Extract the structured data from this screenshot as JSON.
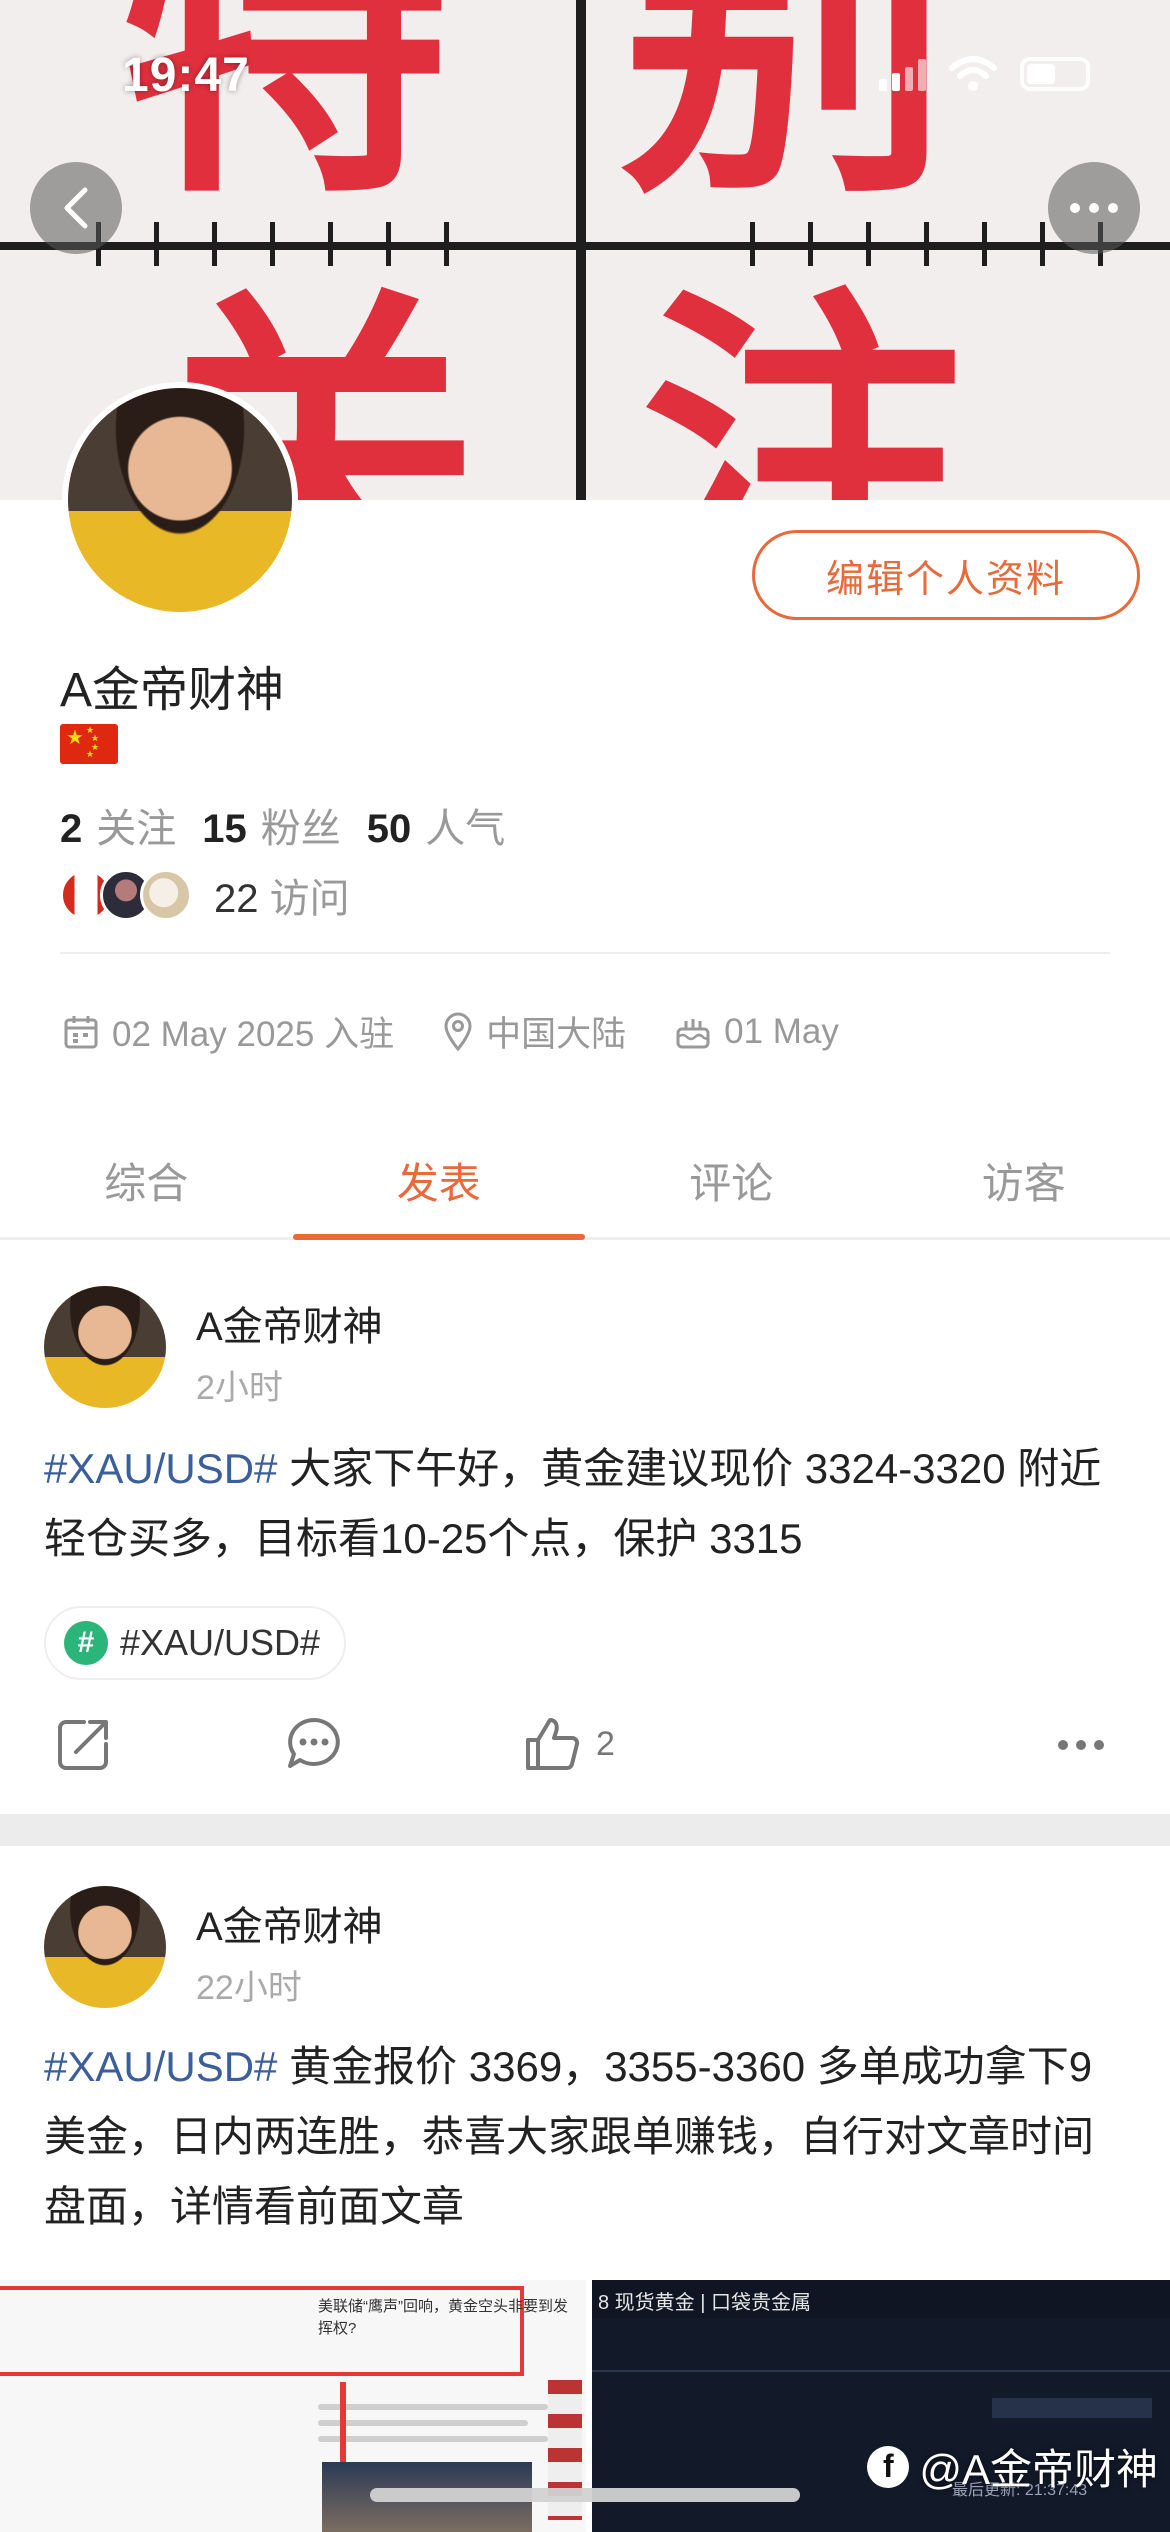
{
  "status_bar": {
    "time": "19:47"
  },
  "banner": {
    "glyphs": [
      "特",
      "别",
      "关",
      "注"
    ]
  },
  "profile": {
    "username": "A金帝财神",
    "edit_button": "编辑个人资料",
    "stats": [
      {
        "value": "2",
        "label": "关注"
      },
      {
        "value": "15",
        "label": "粉丝"
      },
      {
        "value": "50",
        "label": "人气"
      }
    ],
    "visits": {
      "value": "22",
      "label": "访问"
    },
    "joined": "02 May 2025 入驻",
    "location": "中国大陆",
    "birthday": "01 May"
  },
  "tabs": [
    {
      "label": "综合",
      "active": false
    },
    {
      "label": "发表",
      "active": true
    },
    {
      "label": "评论",
      "active": false
    },
    {
      "label": "访客",
      "active": false
    }
  ],
  "posts": [
    {
      "author": "A金帝财神",
      "time": "2小时",
      "tag": "#XAU/USD#",
      "text": " 大家下午好，黄金建议现价 3324-3320 附近轻仓买多，目标看10-25个点，保护 3315",
      "topic": "#XAU/USD#",
      "likes": "2"
    },
    {
      "author": "A金帝财神",
      "time": "22小时",
      "tag": "#XAU/USD#",
      "text": " 黄金报价 3369，3355-3360 多单成功拿下9美金，日内两连胜，恭喜大家跟单赚钱，自行对文章时间盘面，详情看前面文章",
      "image_left_headline": "美联储“鹰声”回响，黄金空头非要到发挥权?",
      "image_right_header": "8 现货黄金 | 口袋贵金属",
      "image_right_time": "最后更新: 21:37:43"
    }
  ],
  "watermark": "@A金帝财神",
  "colors": {
    "accent": "#e8693a",
    "tag": "#3b5f9a",
    "banner_red": "#e0303e"
  }
}
